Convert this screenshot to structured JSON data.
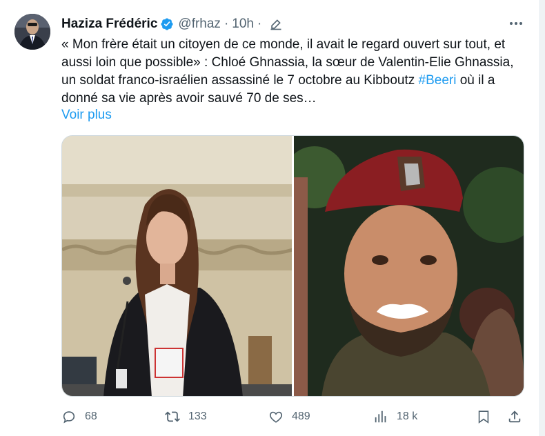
{
  "tweet": {
    "author_name": "Haziza Frédéric",
    "handle": "@frhaz",
    "separator": "·",
    "time": "10h",
    "separator2": "·",
    "body_part1": "« Mon frère était un citoyen de ce monde, il avait le regard ouvert sur tout, et aussi loin que possible» :  Chloé Ghnassia, la sœur de Valentin-Elie Ghnassia, un soldat franco-israélien assassiné le 7 octobre au Kibboutz ",
    "hashtag": "#Beeri",
    "body_part2": " où il a donné sa vie après avoir sauvé 70 de ses…",
    "show_more": "Voir plus"
  },
  "actions": {
    "replies": "68",
    "retweets": "133",
    "likes": "489",
    "views": "18 k"
  },
  "icons": [
    "verified-badge-icon",
    "edit-icon",
    "more-icon",
    "reply-icon",
    "retweet-icon",
    "like-icon",
    "views-icon",
    "bookmark-icon",
    "share-icon"
  ],
  "colors": {
    "accent": "#1d9bf0",
    "muted": "#536471",
    "text": "#0f1419"
  }
}
